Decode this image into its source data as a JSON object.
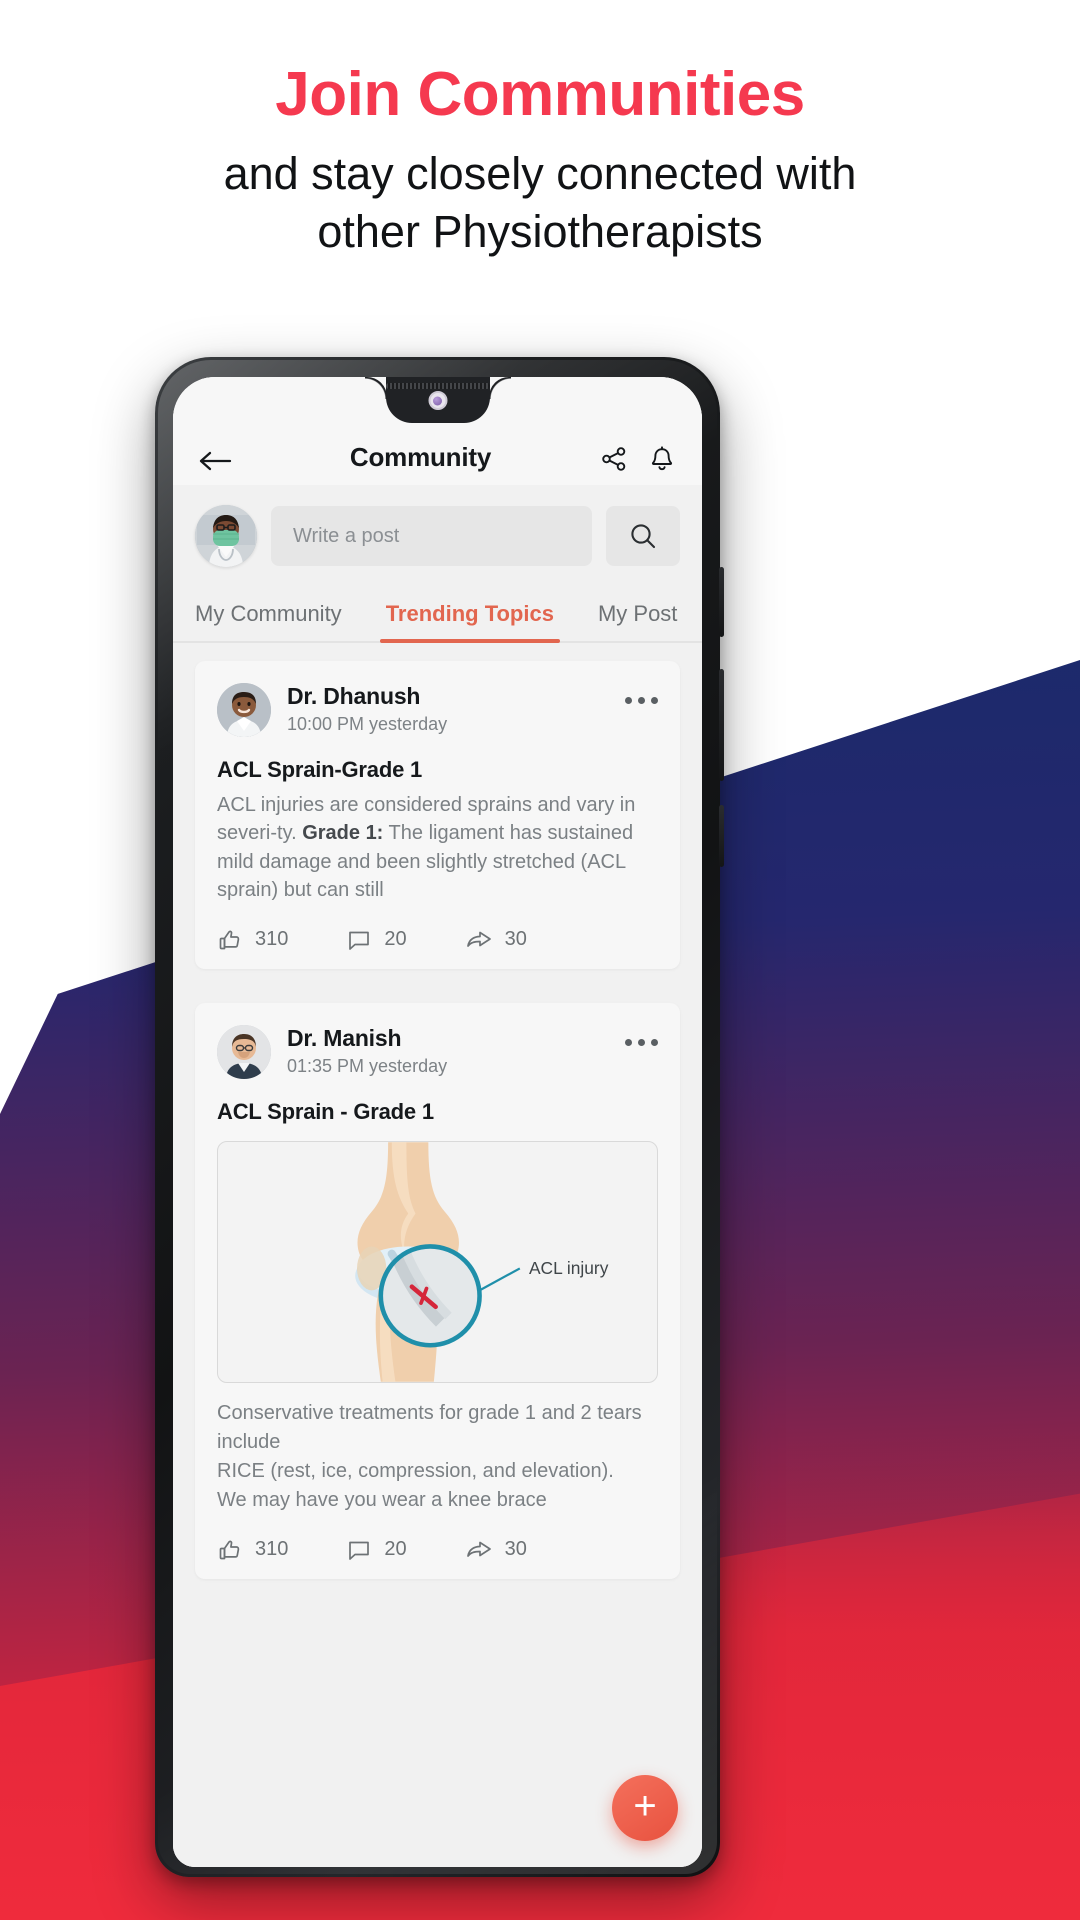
{
  "promo": {
    "headline": "Join Communities",
    "subheadline_line1": "and stay closely connected with",
    "subheadline_line2": "other Physiotherapists",
    "headline_color": "#f5394f"
  },
  "app": {
    "header": {
      "title": "Community",
      "back_icon": "arrow-left-icon",
      "share_icon": "share-icon",
      "bell_icon": "bell-icon"
    },
    "composer": {
      "placeholder": "Write a post",
      "avatar_alt": "user-avatar",
      "search_icon": "search-icon"
    },
    "tabs": [
      {
        "label": "My Community",
        "active": false
      },
      {
        "label": "Trending Topics",
        "active": true
      },
      {
        "label": "My Post",
        "active": false
      }
    ],
    "active_tab_color": "#e2664f",
    "posts": [
      {
        "author": "Dr. Dhanush",
        "time": "10:00 PM yesterday",
        "title": "ACL Sprain-Grade 1",
        "body_part1": "ACL injuries are considered sprains and vary in severi-ty. ",
        "body_bold": "Grade 1:",
        "body_part2": " The ligament has sustained mild damage and been slightly stretched (ACL sprain) but can still",
        "has_image": false,
        "reactions": {
          "likes": "310",
          "comments": "20",
          "shares": "30"
        },
        "more_menu": "post-options"
      },
      {
        "author": "Dr. Manish",
        "time": "01:35 PM yesterday",
        "title": "ACL Sprain - Grade 1",
        "has_image": true,
        "image_caption": "ACL injury",
        "body_line1": "Conservative treatments for grade 1 and 2 tears include",
        "body_line2": "RICE (rest, ice, compression, and elevation).",
        "body_line3": "We may have you wear a knee brace",
        "reactions": {
          "likes": "310",
          "comments": "20",
          "shares": "30"
        },
        "more_menu": "post-options"
      }
    ],
    "fab": {
      "label": "+",
      "color": "#e8523f"
    }
  }
}
